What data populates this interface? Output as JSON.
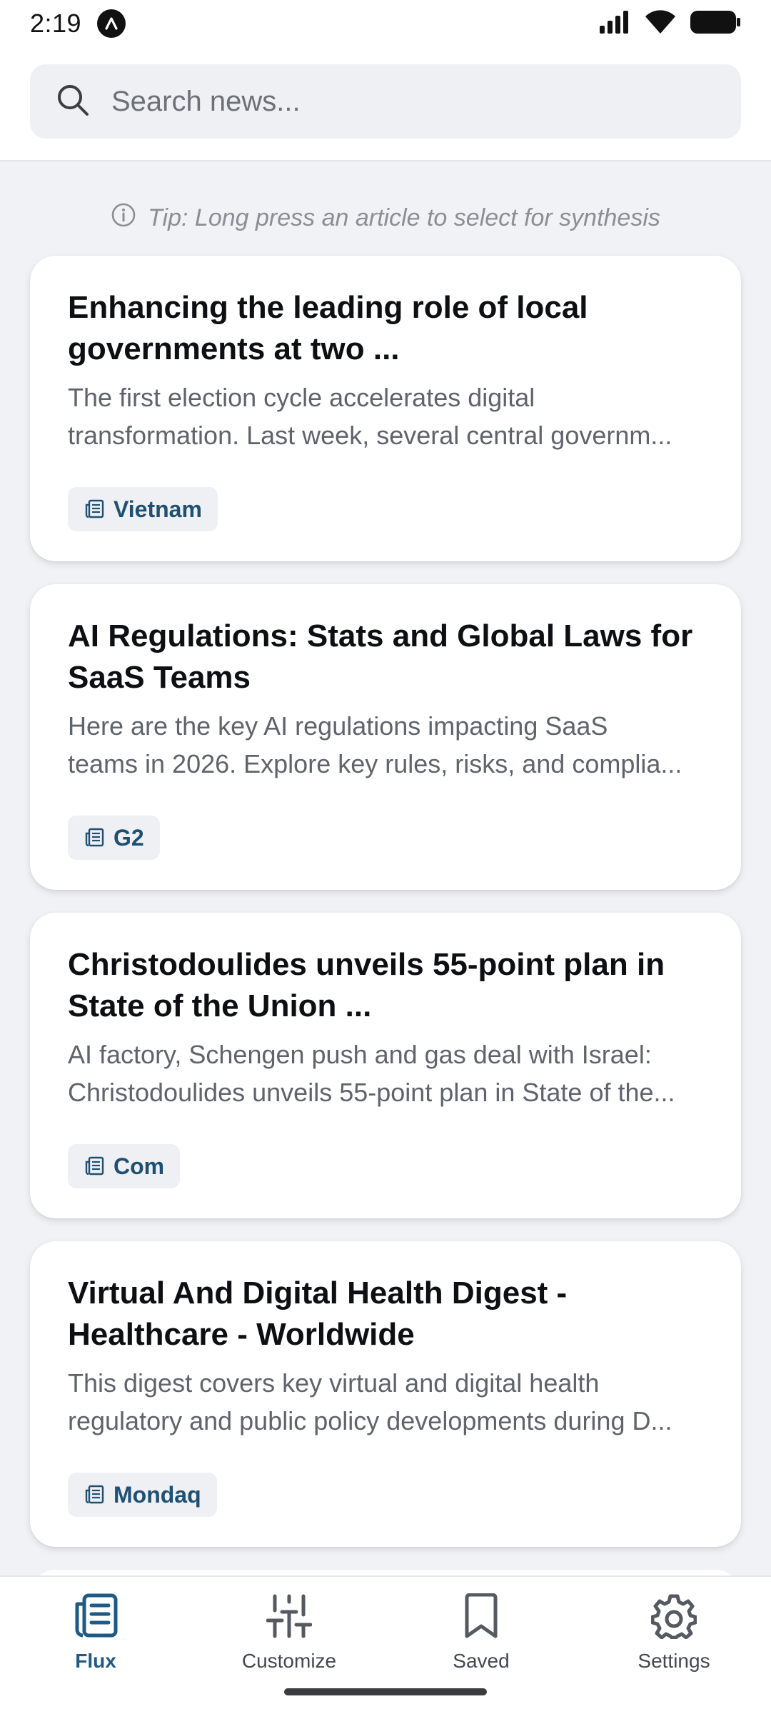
{
  "status_bar": {
    "time": "2:19"
  },
  "search": {
    "placeholder": "Search news..."
  },
  "tip": {
    "text": "Tip: Long press an article to select for synthesis"
  },
  "articles": [
    {
      "title": "Enhancing the leading role of local governments at two ...",
      "desc_line1": "The first election cycle accelerates digital",
      "desc_line2": "transformation. Last week, several central governm...",
      "source": "Vietnam"
    },
    {
      "title": "AI Regulations: Stats and Global Laws for SaaS Teams",
      "desc_line1": "Here are the key AI regulations impacting SaaS",
      "desc_line2": "teams in 2026. Explore key rules, risks, and complia...",
      "source": "G2"
    },
    {
      "title": "Christodoulides unveils 55-point plan in State of the Union ...",
      "desc_line1": "AI factory, Schengen push and gas deal with Israel:",
      "desc_line2": "Christodoulides unveils 55-point plan in State of the...",
      "source": "Com"
    },
    {
      "title": "Virtual And Digital Health Digest - Healthcare - Worldwide",
      "desc_line1": "This digest covers key virtual and digital health",
      "desc_line2": "regulatory and public policy developments during D...",
      "source": "Mondaq"
    }
  ],
  "nav": {
    "items": [
      {
        "label": "Flux",
        "icon": "newspaper-icon",
        "active": true
      },
      {
        "label": "Customize",
        "icon": "sliders-icon",
        "active": false
      },
      {
        "label": "Saved",
        "icon": "bookmark-icon",
        "active": false
      },
      {
        "label": "Settings",
        "icon": "gear-icon",
        "active": false
      }
    ]
  },
  "colors": {
    "accent": "#1e5a84",
    "chip_text": "#1f4f73",
    "background": "#f1f2f5"
  }
}
